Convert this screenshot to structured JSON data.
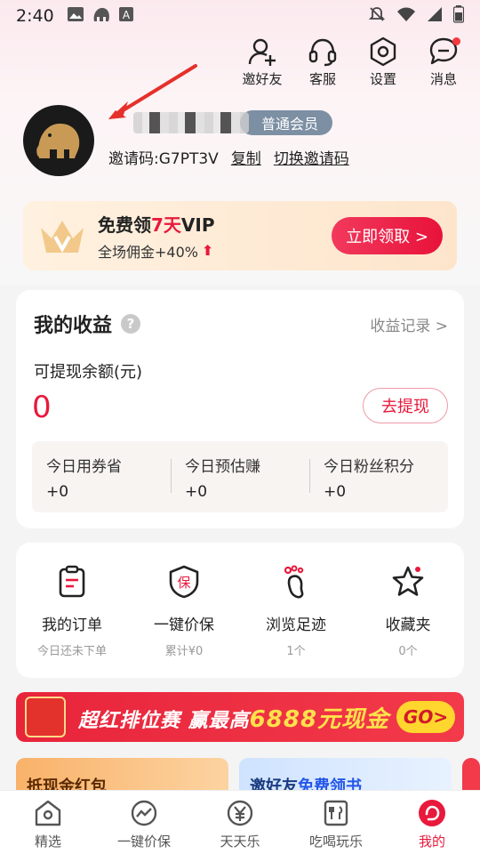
{
  "status_bar": {
    "time": "2:40",
    "left_icons": [
      "image-icon",
      "app-icon",
      "a-icon"
    ],
    "right_icons": [
      "mute-icon",
      "wifi-icon",
      "signal-icon",
      "battery-icon"
    ]
  },
  "top_actions": [
    {
      "label": "邀好友",
      "icon": "add-user-icon"
    },
    {
      "label": "客服",
      "icon": "headset-icon"
    },
    {
      "label": "设置",
      "icon": "settings-icon"
    },
    {
      "label": "消息",
      "icon": "message-icon",
      "has_dot": true
    }
  ],
  "profile": {
    "member_level": "普通会员",
    "invite_label": "邀请码:G7PT3V",
    "copy_label": "复制",
    "switch_label": "切换邀请码"
  },
  "vip_banner": {
    "title_prefix": "免费领",
    "title_highlight": "7天",
    "title_suffix": "VIP",
    "subtitle": "全场佣金+40%",
    "button_label": "立即领取 >"
  },
  "earnings": {
    "title": "我的收益",
    "record_link": "收益记录 >",
    "balance_label": "可提现余额(元)",
    "balance_value": "0",
    "withdraw_label": "去提现",
    "stats": [
      {
        "label": "今日用券省",
        "value": "+0"
      },
      {
        "label": "今日预估赚",
        "value": "+0"
      },
      {
        "label": "今日粉丝积分",
        "value": "+0"
      }
    ]
  },
  "menu": [
    {
      "label": "我的订单",
      "sub": "今日还未下单",
      "icon": "order-icon"
    },
    {
      "label": "一键价保",
      "sub": "累计¥0",
      "icon": "shield-icon"
    },
    {
      "label": "浏览足迹",
      "sub": "1个",
      "icon": "footprint-icon"
    },
    {
      "label": "收藏夹",
      "sub": "0个",
      "icon": "star-icon"
    }
  ],
  "promo": {
    "text_prefix": "超红排位赛 赢最高",
    "amount": "6888元现金",
    "go_label": "GO>"
  },
  "bottom_cards": [
    {
      "title": "抵现金红包"
    },
    {
      "title_prefix": "邀好友",
      "title_highlight": "免费领书"
    }
  ],
  "tabbar": [
    {
      "label": "精选",
      "icon": "home-icon"
    },
    {
      "label": "一键价保",
      "icon": "price-trend-icon"
    },
    {
      "label": "天天乐",
      "icon": "yen-coin-icon"
    },
    {
      "label": "吃喝玩乐",
      "icon": "food-icon"
    },
    {
      "label": "我的",
      "icon": "profile-icon",
      "active": true
    }
  ],
  "colors": {
    "accent": "#e8193c",
    "member_badge": "#7d8fa3",
    "vip_bg": "#fde5cc"
  }
}
